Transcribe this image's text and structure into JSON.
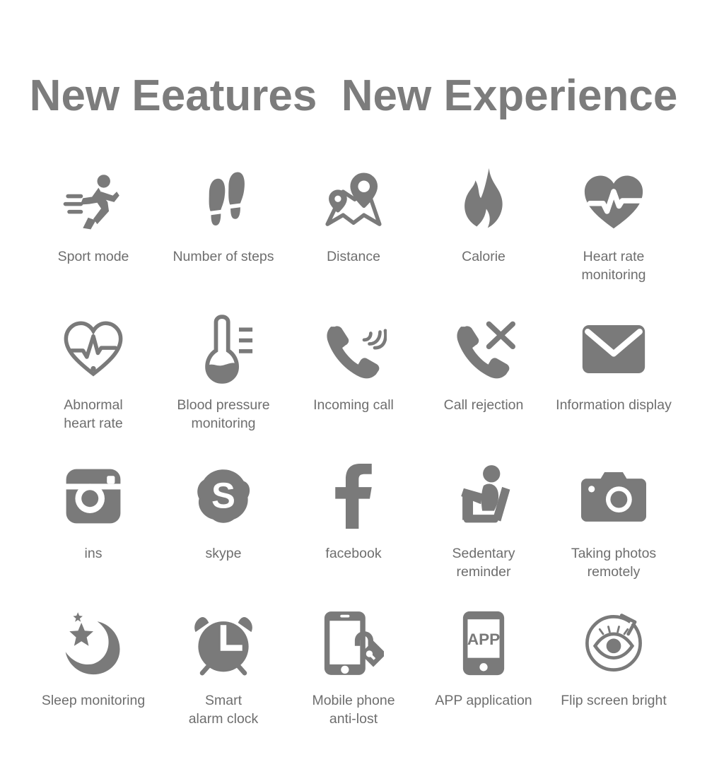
{
  "header": {
    "title": "New Eeatures  New Experience"
  },
  "theme": {
    "icon_color": "#7a7a7a",
    "label_color": "#6e6e6e",
    "title_color": "#7c7c7c",
    "background": "#ffffff"
  },
  "features": {
    "rows": [
      {
        "items": [
          {
            "label": "Sport mode",
            "icon": "running-person-icon"
          },
          {
            "label": "Number of steps",
            "icon": "footprints-icon"
          },
          {
            "label": "Distance",
            "icon": "map-pins-icon"
          },
          {
            "label": "Calorie",
            "icon": "flame-icon"
          },
          {
            "label": "Heart rate\nmonitoring",
            "icon": "heart-pulse-solid-icon"
          }
        ]
      },
      {
        "items": [
          {
            "label": "Abnormal\nheart rate",
            "icon": "heart-pulse-outline-icon"
          },
          {
            "label": "Blood pressure\nmonitoring",
            "icon": "thermometer-icon"
          },
          {
            "label": "Incoming call",
            "icon": "phone-ringing-icon"
          },
          {
            "label": "Call rejection",
            "icon": "phone-reject-icon"
          },
          {
            "label": "Information display",
            "icon": "envelope-icon"
          }
        ]
      },
      {
        "items": [
          {
            "label": "ins",
            "icon": "instagram-icon"
          },
          {
            "label": "skype",
            "icon": "skype-icon"
          },
          {
            "label": "facebook",
            "icon": "facebook-icon"
          },
          {
            "label": "Sedentary\nreminder",
            "icon": "sitting-person-icon"
          },
          {
            "label": "Taking photos\nremotely",
            "icon": "camera-icon"
          }
        ]
      },
      {
        "items": [
          {
            "label": "Sleep monitoring",
            "icon": "moon-stars-icon"
          },
          {
            "label": "Smart\nalarm clock",
            "icon": "alarm-clock-icon"
          },
          {
            "label": "Mobile phone\nanti-lost",
            "icon": "phone-lock-icon"
          },
          {
            "label": "APP application",
            "icon": "phone-app-icon"
          },
          {
            "label": "Flip screen bright",
            "icon": "eye-rotate-icon"
          }
        ]
      }
    ]
  },
  "icon_text": {
    "app_badge": "APP",
    "facebook_glyph": "f",
    "skype_glyph": "S"
  }
}
